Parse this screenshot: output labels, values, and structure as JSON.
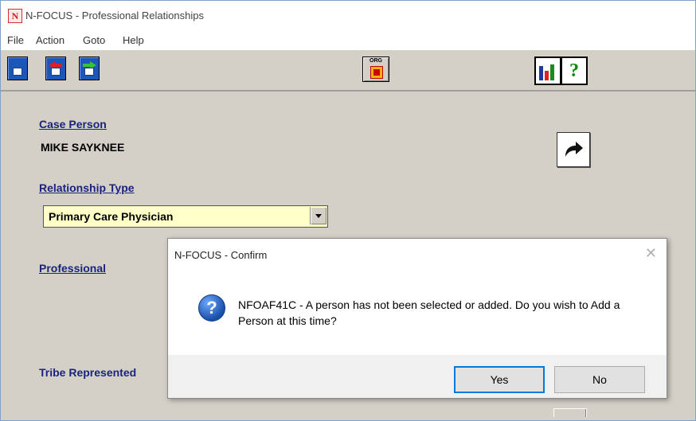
{
  "window": {
    "title": "N-FOCUS - Professional Relationships",
    "app_icon": "N"
  },
  "menu": [
    "File",
    "Action",
    "Goto",
    "Help"
  ],
  "toolbar": {
    "org_label": "ORG",
    "help_symbol": "?"
  },
  "form": {
    "case_person_label": "Case Person",
    "case_person_value": "MIKE SAYKNEE",
    "relationship_type_label": "Relationship Type",
    "relationship_type_value": "Primary Care Physician",
    "professional_label": "Professional",
    "tribe_label": "Tribe Represented"
  },
  "dialog": {
    "title": "N-FOCUS - Confirm",
    "close": "✕",
    "icon_symbol": "?",
    "message": "NFOAF41C - A person has not been selected or added.  Do you wish to Add a Person at this time?",
    "yes": "Yes",
    "no": "No"
  },
  "colors": {
    "label": "#1a237e",
    "combo_bg": "#ffffc8",
    "window_bg": "#d4d0c8",
    "accent": "#0078d7"
  }
}
